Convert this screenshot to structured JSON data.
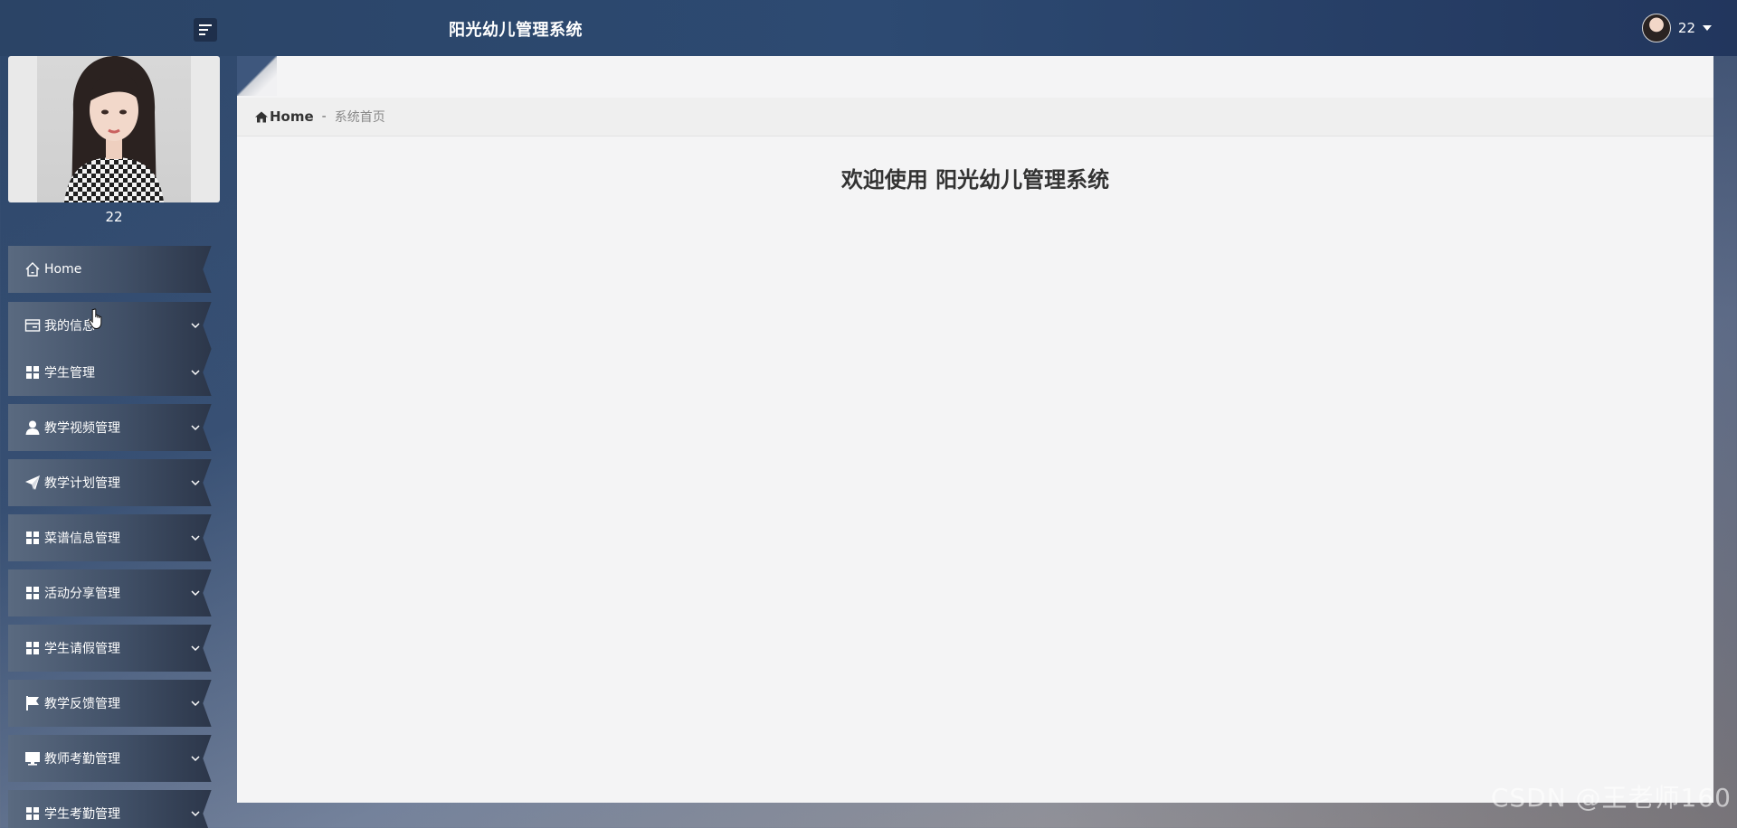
{
  "header": {
    "title": "阳光幼儿管理系统",
    "user_name": "22"
  },
  "sidebar": {
    "profile_name": "22",
    "items": [
      {
        "label": "Home",
        "icon": "home-icon",
        "has_submenu": false
      },
      {
        "label": "我的信息",
        "icon": "id-card-icon",
        "has_submenu": true
      },
      {
        "label": "学生管理",
        "icon": "grid-icon",
        "has_submenu": true
      },
      {
        "label": "教学视频管理",
        "icon": "user-icon",
        "has_submenu": true
      },
      {
        "label": "教学计划管理",
        "icon": "paper-plane-icon",
        "has_submenu": true
      },
      {
        "label": "菜谱信息管理",
        "icon": "grid-icon",
        "has_submenu": true
      },
      {
        "label": "活动分享管理",
        "icon": "grid-icon",
        "has_submenu": true
      },
      {
        "label": "学生请假管理",
        "icon": "grid-icon",
        "has_submenu": true
      },
      {
        "label": "教学反馈管理",
        "icon": "flag-icon",
        "has_submenu": true
      },
      {
        "label": "教师考勤管理",
        "icon": "monitor-icon",
        "has_submenu": true
      },
      {
        "label": "学生考勤管理",
        "icon": "grid-icon",
        "has_submenu": true
      }
    ]
  },
  "breadcrumb": {
    "home": "Home",
    "separator": "-",
    "current": "系统首页"
  },
  "main": {
    "welcome": "欢迎使用 阳光幼儿管理系统"
  },
  "watermark": "CSDN @王老师160",
  "colors": {
    "topbar": "#2d4a72",
    "main_bg": "#f4f4f5",
    "nav_item": "#404f66"
  }
}
